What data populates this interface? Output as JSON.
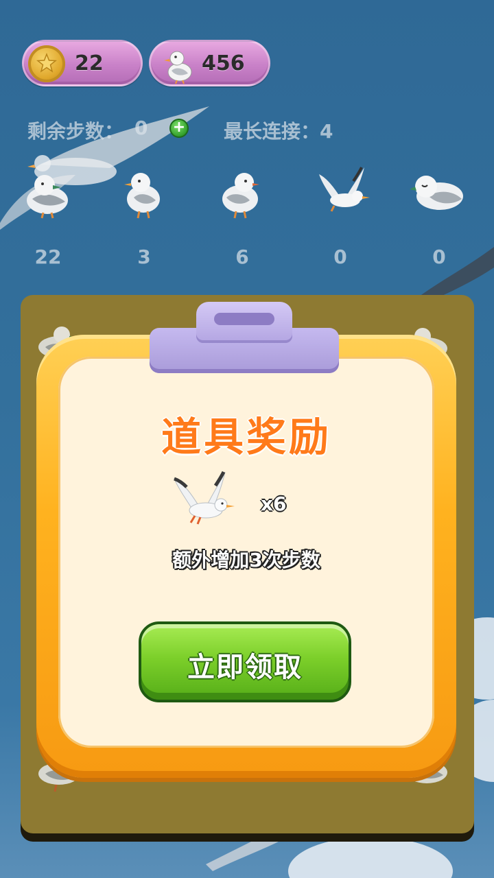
{
  "resources": {
    "coins": "22",
    "gulls": "456"
  },
  "stats": {
    "steps_label": "剩余步数：",
    "steps_value": "0",
    "longest_label": "最长连接：",
    "longest_value": "4"
  },
  "bird_counts": [
    "22",
    "3",
    "6",
    "0",
    "0"
  ],
  "popup": {
    "title": "道具奖励",
    "reward_qty": "x6",
    "reward_desc": "额外增加3次步数",
    "claim_label": "立即领取"
  },
  "colors": {
    "sky": "#33709c",
    "board": "#8e7a32",
    "popup_frame": "#ffb21f",
    "popup_bg": "#fff3dc",
    "title": "#ff7a1a",
    "claim_button": "#7ccf2a",
    "pill": "#c981c8"
  },
  "icons": {
    "coin": "star-coin-icon",
    "gull": "seagull-icon",
    "plus": "plus-icon",
    "reward": "flying-seagull-icon"
  }
}
